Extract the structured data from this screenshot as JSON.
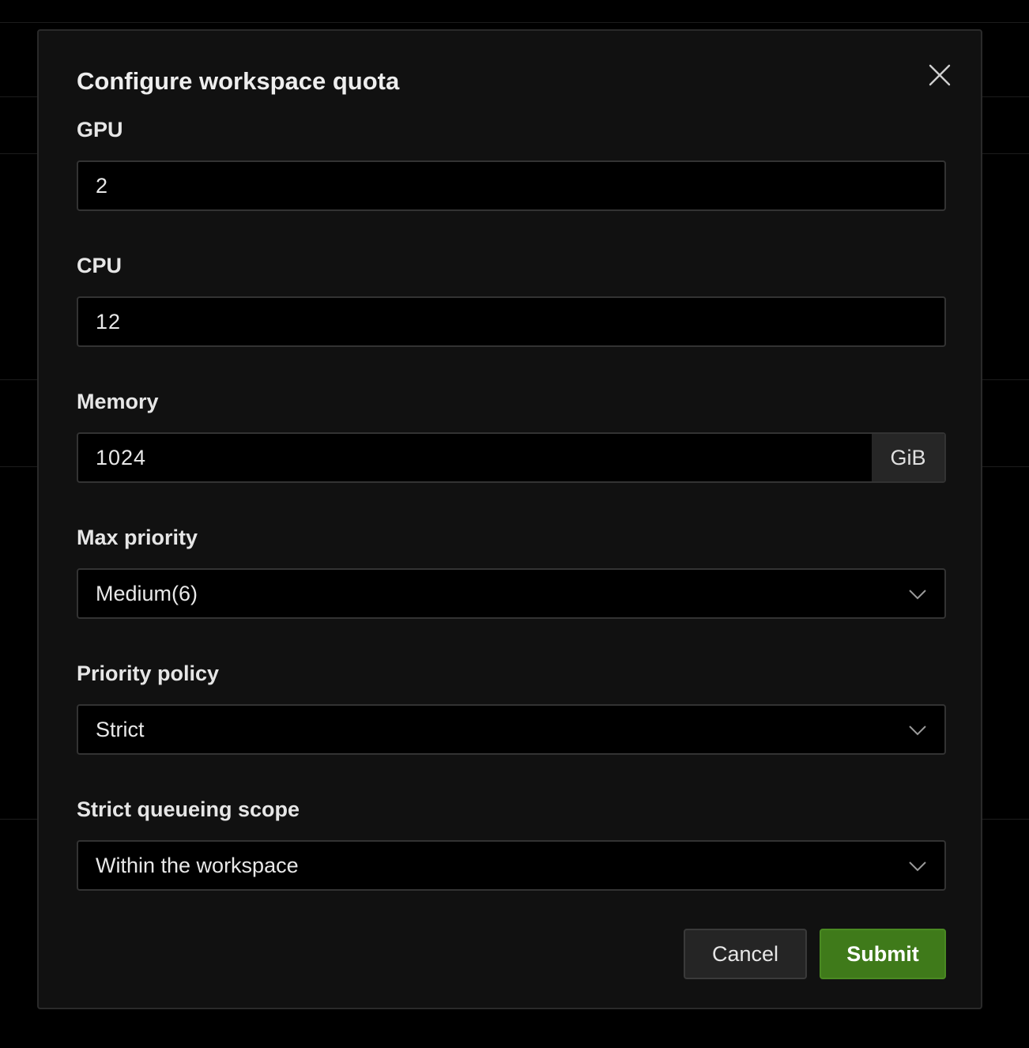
{
  "modal": {
    "title": "Configure workspace quota",
    "close_icon": "close-icon"
  },
  "fields": {
    "gpu": {
      "label": "GPU",
      "value": "2"
    },
    "cpu": {
      "label": "CPU",
      "value": "12"
    },
    "memory": {
      "label": "Memory",
      "value": "1024",
      "unit": "GiB"
    },
    "max_priority": {
      "label": "Max priority",
      "selected": "Medium(6)",
      "icon": "chevron-down-icon"
    },
    "priority_policy": {
      "label": "Priority policy",
      "selected": "Strict",
      "icon": "chevron-down-icon"
    },
    "queueing_scope": {
      "label": "Strict queueing scope",
      "selected": "Within the workspace",
      "icon": "chevron-down-icon"
    }
  },
  "actions": {
    "cancel_label": "Cancel",
    "submit_label": "Submit"
  },
  "colors": {
    "submit_bg": "#3f7a1a",
    "modal_bg": "#111111",
    "input_bg": "#000000"
  }
}
